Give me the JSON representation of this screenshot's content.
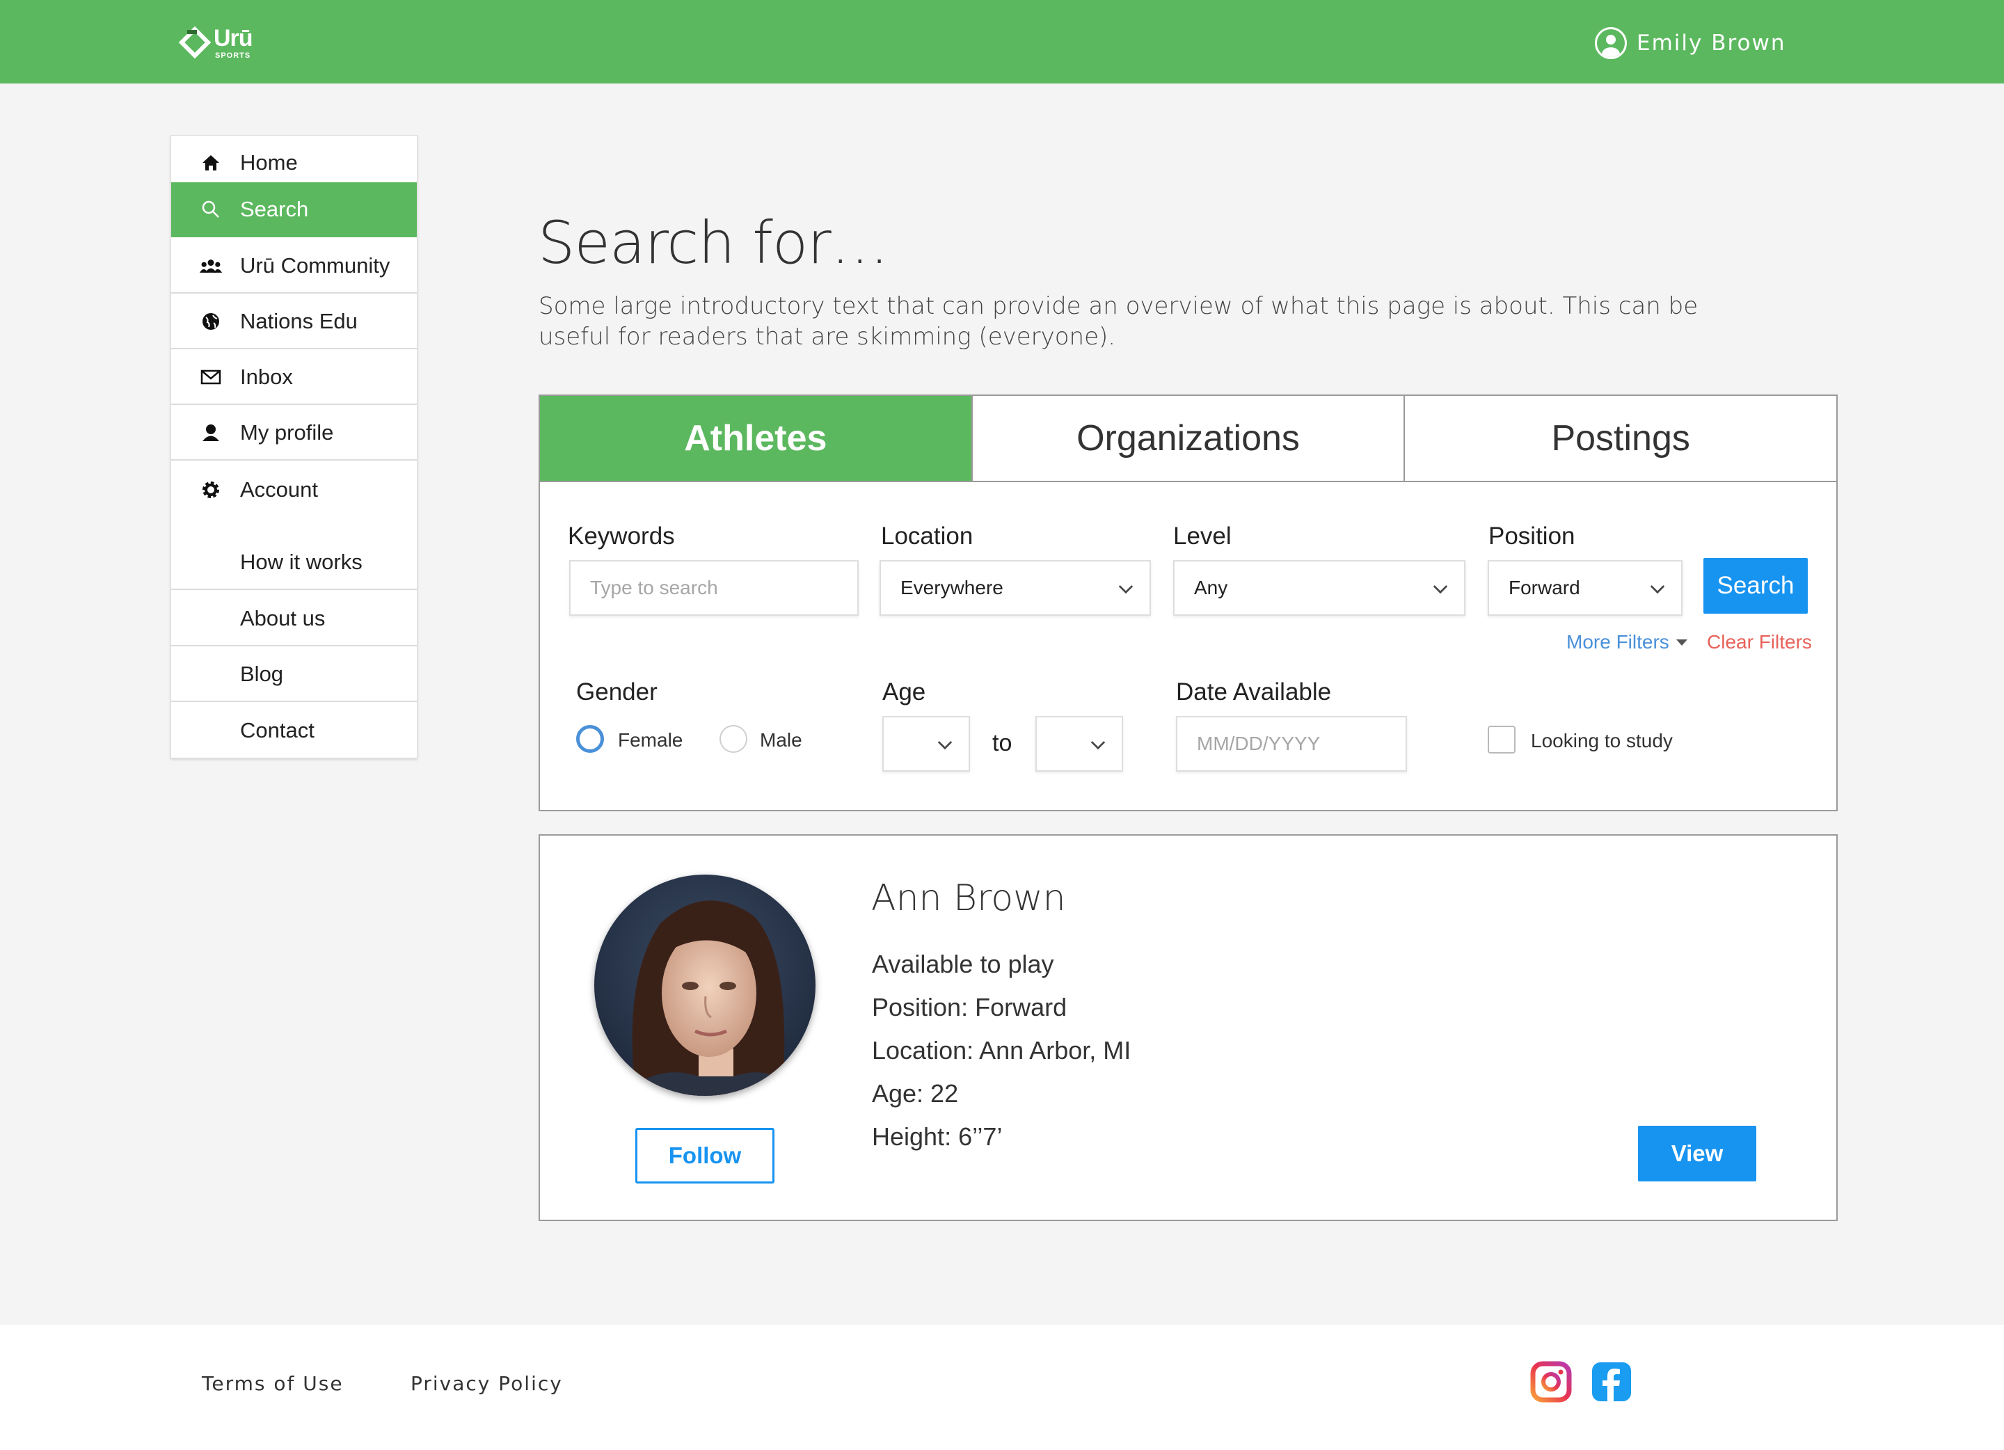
{
  "header": {
    "brand": "Urū",
    "brand_sub": "SPORTS",
    "user_name": "Emily Brown",
    "color": "#5cb85f"
  },
  "sidebar": {
    "items": [
      {
        "label": "Home",
        "icon": "home-icon"
      },
      {
        "label": "Search",
        "icon": "search-icon",
        "active": true
      },
      {
        "label": "Urū Community",
        "icon": "community-icon"
      },
      {
        "label": "Nations Edu",
        "icon": "globe-icon"
      },
      {
        "label": "Inbox",
        "icon": "envelope-icon"
      },
      {
        "label": "My profile",
        "icon": "user-icon"
      },
      {
        "label": "Account",
        "icon": "gear-icon"
      },
      {
        "label": "How it works"
      },
      {
        "label": "About us"
      },
      {
        "label": "Blog"
      },
      {
        "label": "Contact"
      }
    ]
  },
  "main": {
    "title": "Search for…",
    "intro": "Some large introductory text that can provide an overview of what this page is about. This can be useful for readers that are skimming (everyone)."
  },
  "search": {
    "tabs": [
      "Athletes",
      "Organizations",
      "Postings"
    ],
    "active_tab": "Athletes",
    "labels": {
      "keywords": "Keywords",
      "location": "Location",
      "level": "Level",
      "position": "Position",
      "gender": "Gender",
      "age": "Age",
      "date": "Date Available"
    },
    "keywords_placeholder": "Type to search",
    "location_value": "Everywhere",
    "level_value": "Any",
    "position_value": "Forward",
    "search_button": "Search",
    "more_filters": "More Filters",
    "clear_filters": "Clear Filters",
    "gender_options": [
      "Female",
      "Male"
    ],
    "gender_selected": "Female",
    "age_to": "to",
    "date_placeholder": "MM/DD/YYYY",
    "looking_to_study": "Looking to study",
    "accent": "#1793f0"
  },
  "result": {
    "name": "Ann Brown",
    "lines": [
      "Available to play",
      "Position: Forward",
      "Location: Ann Arbor, MI",
      "Age: 22",
      "Height: 6’’7’"
    ],
    "follow_label": "Follow",
    "view_label": "View"
  },
  "footer": {
    "links": [
      "Terms of Use",
      "Privacy Policy"
    ],
    "social": [
      "instagram-icon",
      "facebook-icon"
    ]
  }
}
